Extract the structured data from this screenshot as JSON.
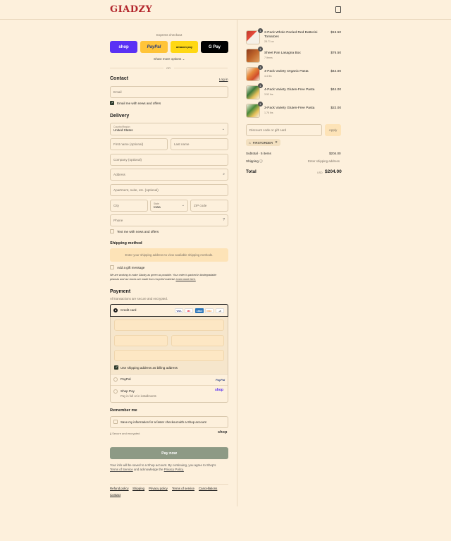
{
  "header": {
    "brand": "GIADZY",
    "cart_icon": "bag-icon"
  },
  "express": {
    "label": "Express checkout",
    "buttons": {
      "shop": "shop",
      "paypal": "PayPal",
      "amazon": "amazon pay",
      "gpay": "G Pay"
    },
    "show_more": "Show more options ⌄",
    "or": "OR"
  },
  "contact": {
    "title": "Contact",
    "login": "Log in",
    "email_placeholder": "Email",
    "news_label": "Email me with news and offers"
  },
  "delivery": {
    "title": "Delivery",
    "country_label": "Country/Region",
    "country_value": "United States",
    "first_name": "First name (optional)",
    "last_name": "Last name",
    "company": "Company (optional)",
    "address": "Address",
    "apartment": "Apartment, suite, etc. (optional)",
    "city": "City",
    "state_label": "State",
    "state_value": "Iowa",
    "zip": "ZIP code",
    "phone": "Phone",
    "text_label": "Text me with news and offers"
  },
  "shipping": {
    "title": "Shipping method",
    "notice": "Enter your shipping address to view available shipping methods.",
    "gift": "Add a gift message",
    "eco_line1": "We are working to make Giadzy as green as possible. Your order is packed in biodegradable",
    "eco_line2": "peanuts and our boxes are made from recycled material.",
    "learn_more": "Learn more here."
  },
  "payment": {
    "title": "Payment",
    "subtitle": "All transactions are secure and encrypted.",
    "credit_card": "Credit card",
    "card_logos": [
      "VISA",
      "MC",
      "AMEX",
      "DISC",
      "+6"
    ],
    "billing_label": "Use shipping address as billing address",
    "paypal": "PayPal",
    "paypal_logo": "PayPal",
    "shop_pay": "Shop Pay",
    "shop_pay_sub": "Pay in full or in installments",
    "shop_logo": "shop"
  },
  "remember": {
    "title": "Remember me",
    "save_label": "Save my information for a faster checkout with a Shop account",
    "secure": "Secure and encrypted",
    "shop_logo": "shop"
  },
  "pay_button": "Pay now",
  "legal": {
    "line1": "Your info will be saved to a Shop account. By continuing, you agree to Shop’s",
    "tos": "Terms of Service",
    "and": "and acknowledge the",
    "privacy": "Privacy Policy."
  },
  "footer_links": [
    "Refund policy",
    "Shipping",
    "Privacy policy",
    "Terms of service",
    "Cancellations",
    "Contact"
  ],
  "cart": {
    "items": [
      {
        "qty": "1",
        "name": "2-Pack Whole Peeled Red Datterini Tomatoes",
        "sub": "28.71 oz",
        "price": "$15.50"
      },
      {
        "qty": "1",
        "name": "Sheet Pan Lasagna Box",
        "sub": "7 Items",
        "price": "$76.50"
      },
      {
        "qty": "1",
        "name": "4-Pack Variety Organic Pasta",
        "sub": "4.4 lbs",
        "price": "$44.00"
      },
      {
        "qty": "1",
        "name": "4-Pack Variety Gluten-Free Pasta",
        "sub": "3.52 lbs",
        "price": "$44.00"
      },
      {
        "qty": "1",
        "name": "3-Pack Variety Gluten-Free Pasta",
        "sub": "1.76 lbs",
        "price": "$22.00"
      }
    ],
    "discount_placeholder": "Discount code or gift card",
    "apply": "Apply",
    "code": "FIRSTORDER",
    "subtotal_label": "Subtotal · 5 items",
    "subtotal": "$204.00",
    "shipping_label": "Shipping",
    "shipping_value": "Enter shipping address",
    "total_label": "Total",
    "currency": "USD",
    "total": "$204.00"
  }
}
